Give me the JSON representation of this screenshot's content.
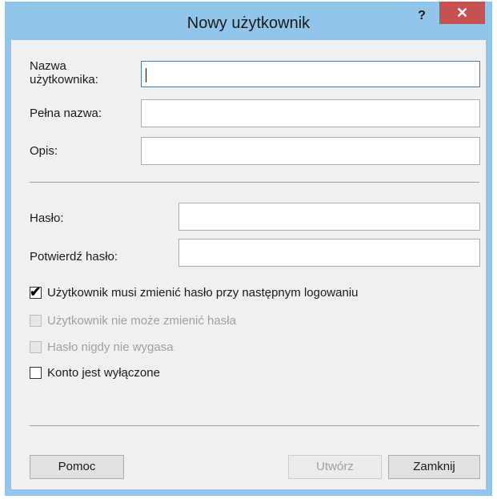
{
  "window": {
    "title": "Nowy użytkownik",
    "help_label": "?",
    "close_label": "✕"
  },
  "fields": {
    "username": {
      "label": "Nazwa\nużytkownika:",
      "value": ""
    },
    "fullname": {
      "label": "Pełna nazwa:",
      "value": ""
    },
    "description": {
      "label": "Opis:",
      "value": ""
    },
    "password": {
      "label": "Hasło:",
      "value": ""
    },
    "confirm_password": {
      "label": "Potwierdź hasło:",
      "value": ""
    }
  },
  "options": {
    "must_change": {
      "label": "Użytkownik musi zmienić hasło przy następnym logowaniu",
      "checked": true,
      "enabled": true
    },
    "cannot_change": {
      "label": "Użytkownik nie może zmienić hasła",
      "checked": false,
      "enabled": false
    },
    "never_expires": {
      "label": "Hasło nigdy nie wygasa",
      "checked": false,
      "enabled": false
    },
    "disabled": {
      "label": "Konto jest wyłączone",
      "checked": false,
      "enabled": true
    }
  },
  "buttons": {
    "help": "Pomoc",
    "create": "Utwórz",
    "close": "Zamknij"
  },
  "check_glyph": "✔"
}
